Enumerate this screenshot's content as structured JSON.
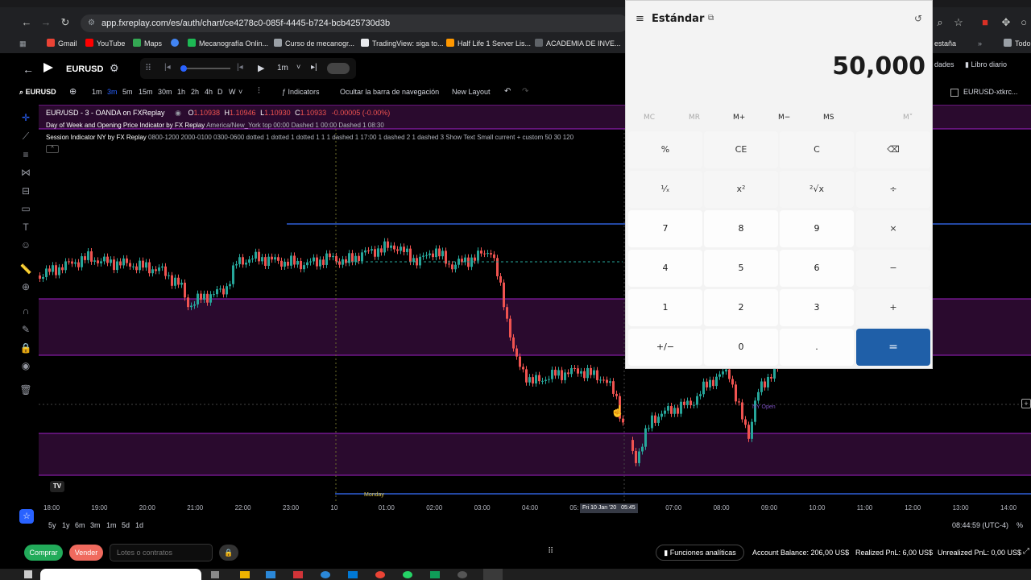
{
  "browser": {
    "url": "app.fxreplay.com/es/auth/chart/ce4278c0-085f-4445-b724-bcb425730d3b",
    "bookmarks": [
      {
        "label": "Gmail",
        "color": "#ea4335"
      },
      {
        "label": "YouTube",
        "color": "#ff0000"
      },
      {
        "label": "Maps",
        "color": "#34a853"
      },
      {
        "label": "",
        "color": "#4285f4"
      },
      {
        "label": "Mecanografía Onlin...",
        "color": "#1db954"
      },
      {
        "label": "Curso de mecanogr...",
        "color": "#9aa0a6"
      },
      {
        "label": "TradingView: siga to...",
        "color": "#e8eaed"
      },
      {
        "label": "Half Life 1 Server Lis...",
        "color": "#ff9800"
      },
      {
        "label": "ACADEMIA DE INVE...",
        "color": "#5f6368"
      }
    ],
    "bookmarks_right": [
      "estaña",
      "Todo"
    ]
  },
  "replay": {
    "symbol": "EURUSD",
    "speed": "1m"
  },
  "toolbar": {
    "symbol": "EURUSD",
    "timeframes": [
      "1m",
      "3m",
      "5m",
      "15m",
      "30m",
      "1h",
      "2h",
      "4h",
      "D",
      "W"
    ],
    "active_timeframe": "3m",
    "indicators_label": "Indicators",
    "hide_nav_label": "Ocultar la barra de navegación",
    "layout_label": "New Layout",
    "right_tab1": "dades",
    "right_tab2": "Libro diario",
    "right_layout": "EURUSD-xtkrc..."
  },
  "legend": {
    "title": "EUR/USD - 3 - OANDA on FXReplay",
    "o": "1.10938",
    "h": "1.10946",
    "l": "1.10930",
    "c": "1.10933",
    "chg": "-0.00005 (-0.00%)",
    "line2_name": "Day of Week and Opening Price Indicator by FX Replay",
    "line2_params": "America/New_York top 00:00 Dashed 1 00:00 Dashed 1 08:30",
    "line3_name": "Session Indicator NY by FX Replay",
    "line3_params": "0800-1200 2000-0100 0300-0600 dotted 1 dotted 1 dotted 1 1 1 dashed 1 17:00 1 dashed 2 1 dashed 3 Show Text Small current + custom 50 30 120"
  },
  "chart_labels": {
    "ny_open": "NY Open",
    "monday": "Monday"
  },
  "time_axis": {
    "ticks": [
      "18:00",
      "19:00",
      "20:00",
      "21:00",
      "22:00",
      "23:00",
      "10",
      "01:00",
      "02:00",
      "03:00",
      "04:00",
      "05:",
      "",
      "07:00",
      "08:00",
      "09:00",
      "10:00",
      "11:00",
      "12:00",
      "13:00",
      "14:00"
    ],
    "cursor_label": "Fri 10 Jan '20",
    "cursor_time": "05:45"
  },
  "range_bar": {
    "ranges": [
      "5y",
      "1y",
      "6m",
      "3m",
      "1m",
      "5d",
      "1d"
    ],
    "clock": "08:44:59 (UTC-4)",
    "percent": "%"
  },
  "bottom": {
    "buy": "Comprar",
    "sell": "Vender",
    "lots_placeholder": "Lotes o contratos",
    "analytics": "Funciones analíticas",
    "account_balance": "Account Balance: 206,00 US$",
    "realized": "Realized PnL: 6,00 US$",
    "unrealized": "Unrealized PnL: 0,00 US$"
  },
  "calculator": {
    "mode": "Estándar",
    "display": "50,000",
    "memory": [
      "MC",
      "MR",
      "M+",
      "M−",
      "MS",
      "M˅"
    ],
    "rows": [
      [
        "%",
        "CE",
        "C",
        "⌫"
      ],
      [
        "¹⁄ₓ",
        "x²",
        "²√x",
        "÷"
      ],
      [
        "7",
        "8",
        "9",
        "×"
      ],
      [
        "4",
        "5",
        "6",
        "−"
      ],
      [
        "1",
        "2",
        "3",
        "+"
      ],
      [
        "+/−",
        "0",
        ".",
        "="
      ]
    ]
  },
  "colors": {
    "session_fill": "#2a0a2e",
    "session_line": "#a020c8",
    "blue_line": "#2f5fd8",
    "bull": "#26a69a",
    "bear": "#ef5350",
    "calc_accent": "#1f5fa8"
  }
}
